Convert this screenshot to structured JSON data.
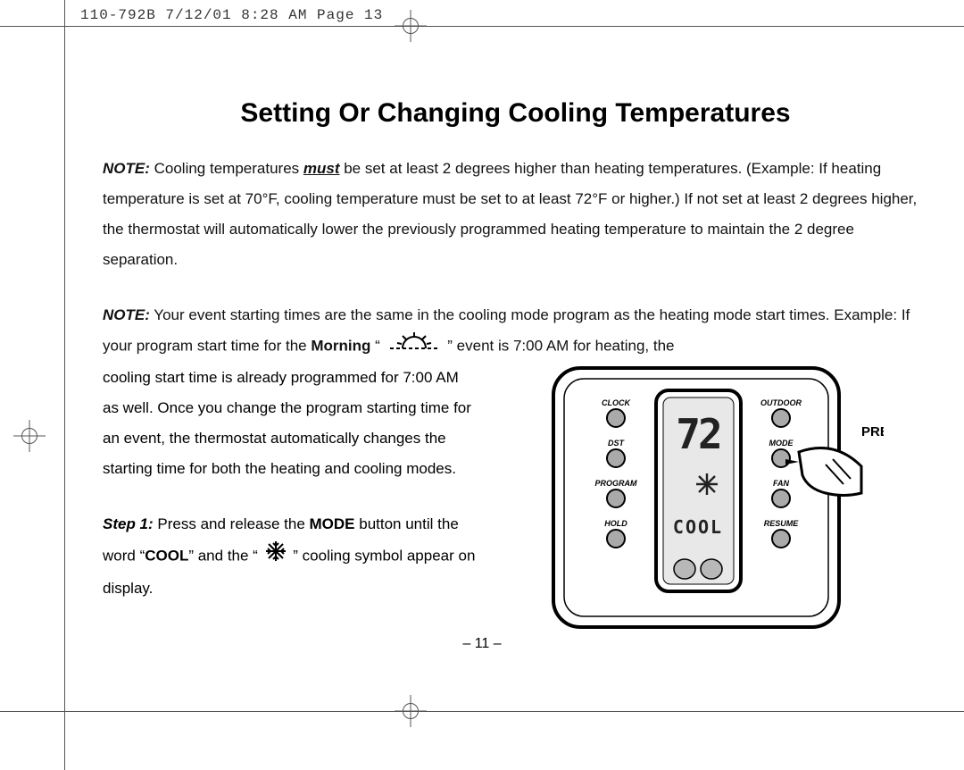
{
  "header": "110-792B  7/12/01  8:28 AM  Page 13",
  "title": "Setting Or Changing Cooling Temperatures",
  "note1": {
    "label": "NOTE:",
    "pre": " Cooling temperatures ",
    "must": "must",
    "post": " be set at least 2 degrees higher than heating temperatures. (Example: If heating temperature is set at 70°F, cooling temperature must be set to at least 72°F or higher.) If not set at least 2 degrees higher, the thermostat will automatically lower the previously programmed heating temperature to maintain the 2 degree separation."
  },
  "note2": {
    "label": "NOTE:",
    "part1": " Your event starting times are the same in the cooling mode program as the heating mode start times. Example: If your program start time for the ",
    "morning": "Morning",
    "part1b": " “",
    "part1c": "” event is 7:00 AM for heating, the",
    "part2": "cooling start time is already programmed for 7:00 AM as well. Once you change the program starting time for an event, the thermostat automatically changes the starting time for both the heating and cooling modes."
  },
  "step1": {
    "label": "Step 1:",
    "part1": " Press and release the ",
    "mode": "MODE",
    "part2": " button until the word “",
    "cool": "COOL",
    "part3": "” and the “ ",
    "part4": " ” cooling symbol appear on display."
  },
  "thermo": {
    "press": "PRESS",
    "temp": "72",
    "mode_text": "COOL",
    "left_buttons": [
      "CLOCK",
      "DST",
      "PROGRAM",
      "HOLD"
    ],
    "right_buttons": [
      "OUTDOOR",
      "MODE",
      "FAN",
      "RESUME"
    ]
  },
  "page_num": "– 11 –"
}
